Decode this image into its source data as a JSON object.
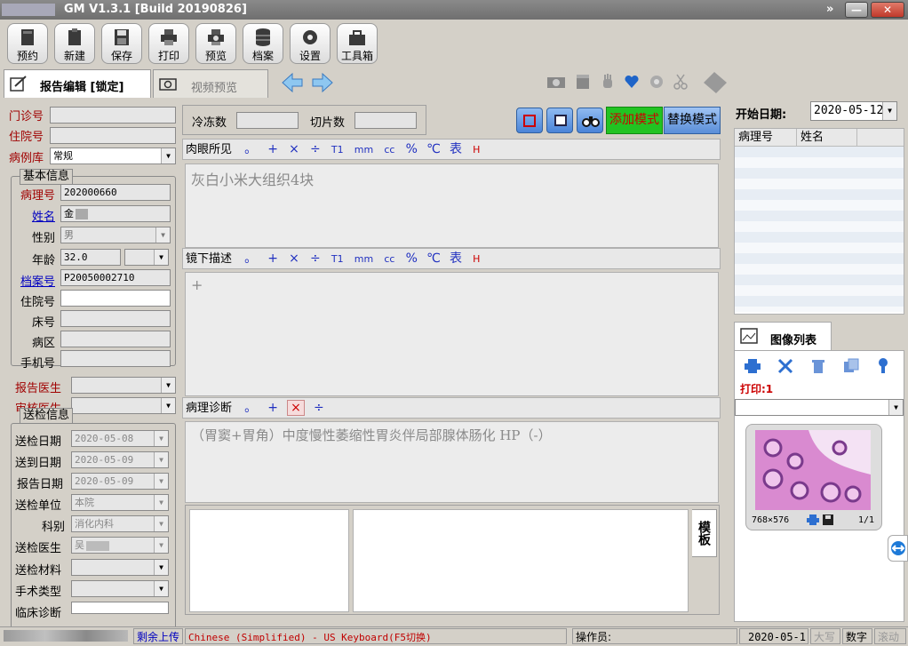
{
  "window": {
    "title": "GM  V1.3.1 [Build 20190826]",
    "controls": [
      "»",
      "—",
      "✕"
    ]
  },
  "toolbar": [
    {
      "label": "预约",
      "icon": "document-icon"
    },
    {
      "label": "新建",
      "icon": "clipboard-icon"
    },
    {
      "label": "保存",
      "icon": "floppy-icon"
    },
    {
      "label": "打印",
      "icon": "printer-icon"
    },
    {
      "label": "预览",
      "icon": "preview-icon"
    },
    {
      "label": "档案",
      "icon": "database-icon"
    },
    {
      "label": "设置",
      "icon": "gear-icon"
    },
    {
      "label": "工具箱",
      "icon": "toolbox-icon"
    }
  ],
  "tabs": {
    "report": "报告编辑 [锁定]",
    "video": "视频预览"
  },
  "left": {
    "outpatient_label": "门诊号",
    "outpatient_value": "",
    "inpatient_label": "住院号",
    "inpatient_value": "",
    "case_db_label": "病例库",
    "case_db_value": "常规",
    "basic_info_title": "基本信息",
    "pathology_no_label": "病理号",
    "pathology_no": "202000660",
    "name_label": "姓名",
    "name_value": "金",
    "gender_label": "性别",
    "gender_value": "男",
    "age_label": "年龄",
    "age_value": "32.0",
    "archive_label": "档案号",
    "archive_value": "P20050002710",
    "inpatient2_label": "住院号",
    "bed_label": "床号",
    "ward_label": "病区",
    "phone_label": "手机号",
    "report_doctor_label": "报告医生",
    "review_doctor_label": "审核医生",
    "send_info_title": "送检信息",
    "send_date_label": "送检日期",
    "send_date": "2020-05-08",
    "arrive_date_label": "送到日期",
    "arrive_date": "2020-05-09",
    "report_date_label": "报告日期",
    "report_date": "2020-05-09",
    "send_unit_label": "送检单位",
    "send_unit": "本院",
    "dept_label": "科别",
    "dept": "消化内科",
    "send_doctor_label": "送检医生",
    "send_doctor": "吴",
    "material_label": "送检材料",
    "surgery_label": "手术类型",
    "clinical_label": "临床诊断"
  },
  "center": {
    "frozen_label": "冷冻数",
    "slice_label": "切片数",
    "btn_add_mode": "添加模式",
    "btn_replace_mode": "替换模式",
    "gross_label": "肉眼所见",
    "gross_text": "灰白小米大组织4块",
    "micro_label": "镜下描述",
    "micro_text": "+",
    "diagnosis_label": "病理诊断",
    "diagnosis_text": "（胃窦+胃角）中度慢性萎缩性胃炎伴局部腺体肠化   HP（-）",
    "template_label": "模板",
    "symbols": [
      "。",
      "+",
      "×",
      "÷",
      "T1",
      "mm",
      "cc",
      "%",
      "℃",
      "表",
      "H"
    ],
    "diag_symbols": [
      "。",
      "+",
      "×",
      "÷"
    ]
  },
  "right": {
    "start_date_label": "开始日期:",
    "start_date": "2020-05-12",
    "col_pathology": "病理号",
    "col_name": "姓名",
    "image_list_label": "图像列表",
    "print_count": "打印:1",
    "thumb_size": "768×576",
    "thumb_page": "1/1"
  },
  "status": {
    "remaining": "剩余上传",
    "ime": "Chinese (Simplified) - US Keyboard(F5切换)",
    "operator_label": "操作员:",
    "date": "2020-05-1",
    "caps": "大写",
    "num": "数字",
    "scroll": "滚动"
  },
  "colors": {
    "accent_green": "#22c322",
    "accent_blue": "#2d6fd0",
    "label_red": "#a00000",
    "label_blue": "#0000c0"
  }
}
